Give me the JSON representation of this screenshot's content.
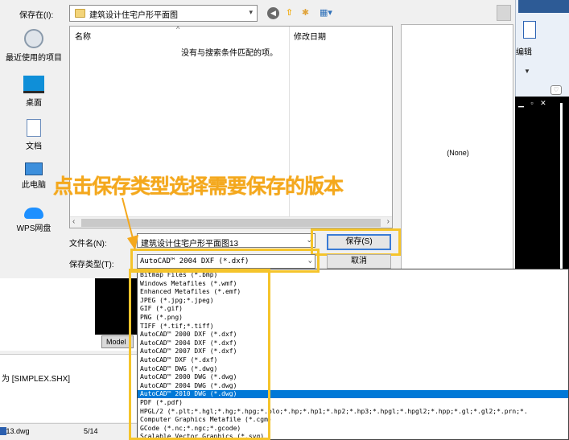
{
  "dialog": {
    "save_in_label": "保存在(I):",
    "current_folder": "建筑设计住宅户形平面图",
    "columns": {
      "name": "名称",
      "modified": "修改日期"
    },
    "empty_message": "没有与搜索条件匹配的项。",
    "preview_text": "(None)",
    "places": [
      {
        "label": "最近使用的项目",
        "icon": "recent-icon"
      },
      {
        "label": "桌面",
        "icon": "desktop-icon"
      },
      {
        "label": "文档",
        "icon": "documents-icon"
      },
      {
        "label": "此电脑",
        "icon": "computer-icon"
      },
      {
        "label": "WPS网盘",
        "icon": "cloud-icon"
      }
    ],
    "filename_label": "文件名(N):",
    "filename_value": "建筑设计住宅户形平面图13",
    "filetype_label": "保存类型(T):",
    "filetype_value": "AutoCAD™ 2004 DXF (*.dxf)",
    "save_button": "保存(S)",
    "cancel_button": "取消",
    "file_types": [
      "Bitmap Files (*.bmp)",
      "Windows Metafiles (*.wmf)",
      "Enhanced Metafiles (*.emf)",
      "JPEG (*.jpg;*.jpeg)",
      "GIF (*.gif)",
      "PNG (*.png)",
      "TIFF (*.tif;*.tiff)",
      "AutoCAD™ 2000 DXF (*.dxf)",
      "AutoCAD™ 2004 DXF (*.dxf)",
      "AutoCAD™ 2007 DXF (*.dxf)",
      "AutoCAD™ DXF (*.dxf)",
      "AutoCAD™ DWG (*.dwg)",
      "AutoCAD™ 2000 DWG (*.dwg)",
      "AutoCAD™ 2004 DWG (*.dwg)",
      "AutoCAD™ 2010 DWG (*.dwg)",
      "PDF (*.pdf)",
      "HPGL/2 (*.plt;*.hgl;*.hg;*.hpg;*.plo;*.hp;*.hp1;*.hp2;*.hp3;*.hpgl;*.hpgl2;*.hpp;*.gl;*.gl2;*.prn;*.",
      "Computer Graphics Metafile (*.cgm)",
      "GCode (*.nc;*.ngc;*.gcode)",
      "Scalable Vector Graphics (*.svg)"
    ],
    "selected_type_index": 14
  },
  "annotation": {
    "text": "点击保存类型选择需要保存的版本",
    "color": "#f4a81d",
    "highlight_color": "#f5c42b"
  },
  "app": {
    "edit_label": "编辑",
    "window_controls": "▁ ▫ ✕",
    "model_tab": "Model",
    "command_text": "为 [SIMPLEX.SHX]",
    "status_file": "13.dwg",
    "status_page": "5/14"
  }
}
